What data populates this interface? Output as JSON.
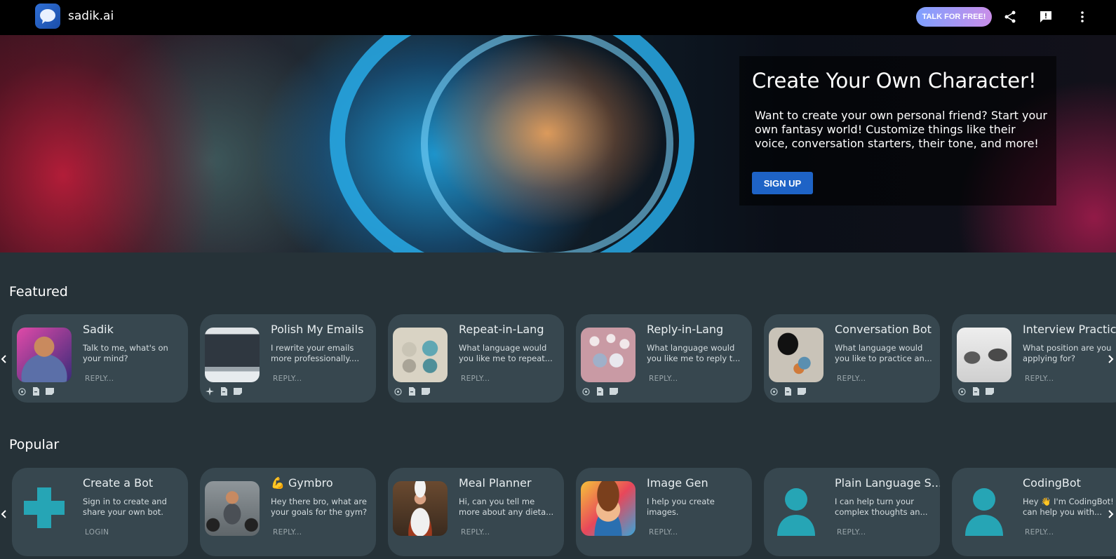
{
  "app": {
    "brand": "sadik.ai"
  },
  "header": {
    "talk_label": "TALK FOR FREE!",
    "icons": [
      "share-icon",
      "feedback-icon",
      "more-vert-icon"
    ]
  },
  "hero": {
    "title": "Create Your Own Character!",
    "text": "Want to create your own personal friend? Start your own fantasy world! Customize things like their voice, conversation starters, their tone, and more!",
    "signup_label": "SIGN UP"
  },
  "featured": {
    "title": "Featured",
    "cards": [
      {
        "title": "Sadik",
        "desc": "Talk to me, what's on your mind?",
        "action": "REPLY..."
      },
      {
        "title": "Polish My Emails",
        "desc": "I rewrite your emails more professionally....",
        "action": "REPLY..."
      },
      {
        "title": "Repeat-in-Lang",
        "desc": "What language would you like me to repeat...",
        "action": "REPLY..."
      },
      {
        "title": "Reply-in-Lang",
        "desc": "What language would you like me to reply t...",
        "action": "REPLY..."
      },
      {
        "title": "Conversation Bot",
        "desc": "What language would you like to practice an...",
        "action": "REPLY..."
      },
      {
        "title": "Interview Practice",
        "desc": "What position are you applying for?",
        "action": "REPLY..."
      }
    ]
  },
  "popular": {
    "title": "Popular",
    "cards": [
      {
        "title": "Create a Bot",
        "desc": "Sign in to create and share your own bot.",
        "action": "LOGIN"
      },
      {
        "title": "💪 Gymbro",
        "desc": "Hey there bro, what are your goals for the gym?",
        "action": "REPLY..."
      },
      {
        "title": "Meal Planner",
        "desc": "Hi, can you tell me more about any dieta...",
        "action": "REPLY..."
      },
      {
        "title": "Image Gen",
        "desc": "I help you create images.",
        "action": "REPLY..."
      },
      {
        "title": "Plain Language S...",
        "desc": "I can help turn your complex thoughts an...",
        "action": "REPLY..."
      },
      {
        "title": "CodingBot",
        "desc": "Hey 👋 I'm CodingBot! I can help you with...",
        "action": "REPLY..."
      }
    ]
  },
  "colors": {
    "accent": "#1e63c6",
    "card_bg": "#37474f",
    "page_bg": "#263238",
    "teal": "#26a5b5"
  }
}
